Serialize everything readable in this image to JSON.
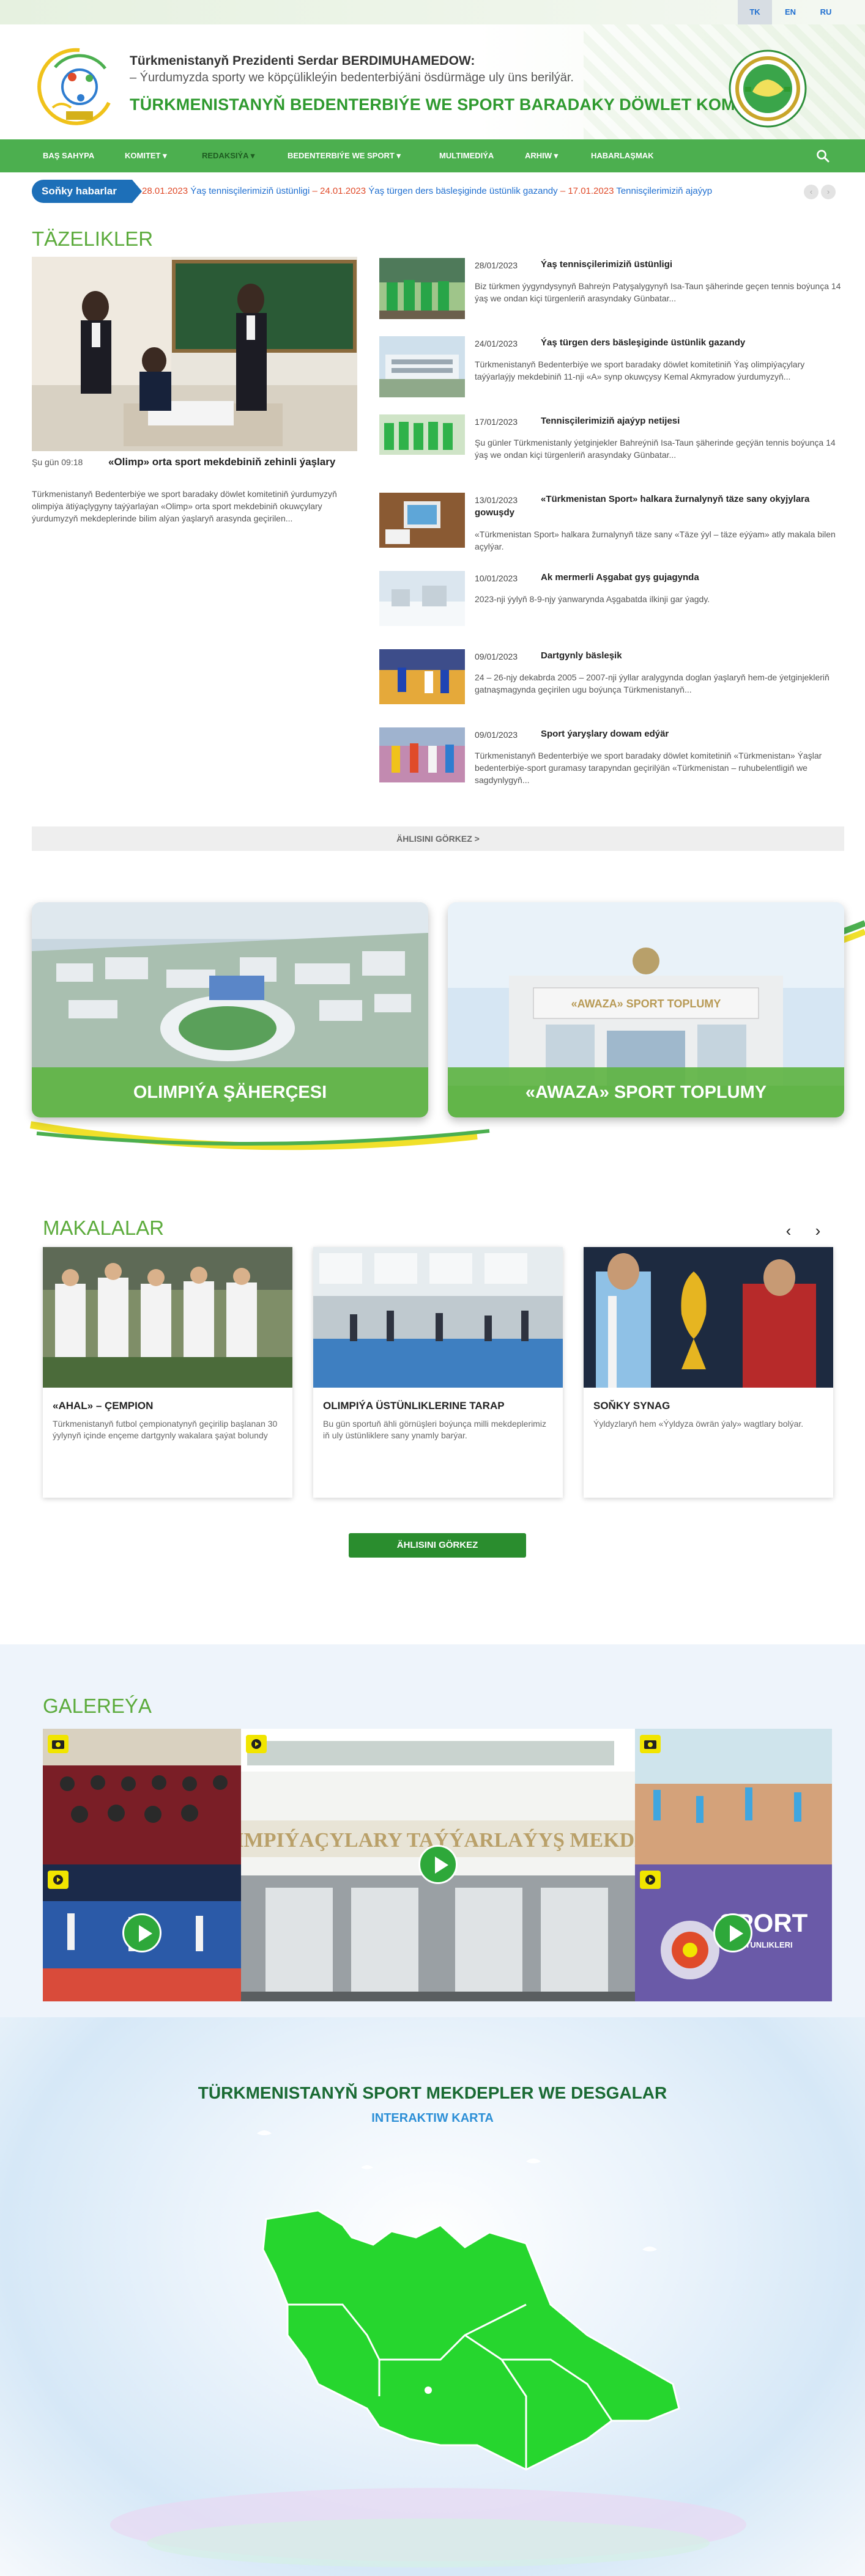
{
  "languages": [
    {
      "code": "TK",
      "active": true
    },
    {
      "code": "EN",
      "active": false
    },
    {
      "code": "RU",
      "active": false
    }
  ],
  "header": {
    "line1": "Türkmenistanyň Prezidenti Serdar BERDIMUHAMEDOW:",
    "line2": "– Ýurdumyzda sporty we köpçülikleýin bedenterbiýäni ösdürmäge uly üns berilýär.",
    "title": "TÜRKMENISTANYŇ BEDENTERBIÝE WE SPORT BARADAKY DÖWLET KOMITETI"
  },
  "nav": [
    {
      "label": "BAŞ SAHYPA"
    },
    {
      "label": "KOMITET ▾"
    },
    {
      "label": "REDAKSIÝA ▾"
    },
    {
      "label": "BEDENTERBIÝE WE SPORT ▾"
    },
    {
      "label": "MULTIMEDIÝA"
    },
    {
      "label": "ARHIW ▾"
    },
    {
      "label": "HABARLAŞMAK"
    }
  ],
  "ticker": {
    "label": "Soňky habarlar",
    "items": [
      {
        "date": "28.01.2023",
        "title": "Ýaş tennisçilerimiziň üstünligi"
      },
      {
        "date": "24.01.2023",
        "title": "Ýaş türgen ders bäsleşiginde üstünlik gazandy"
      },
      {
        "date": "17.01.2023",
        "title": "Tennisçilerimiziň ajaýyp"
      }
    ]
  },
  "news_section": {
    "title": "TÄZELIKLER",
    "featured": {
      "date": "Şu gün 09:18",
      "title": "«Olimp» orta sport mekdebiniň zehinli ýaşlary",
      "text": "Türkmenistanyň Bedenterbiýe we sport baradaky döwlet komitetiniň ýurdumyzyň olimpiýa ätiýaçlygyny taýýarlaýan «Olimp» orta sport mekdebiniň okuwçylary ýurdumyzyň mekdeplerinde bilim alýan ýaşlaryň arasynda geçirilen..."
    },
    "items": [
      {
        "date": "28/01/2023",
        "title": "Ýaş tennisçilerimiziň üstünligi",
        "text": "Biz türkmen ýygyndysynyň Bahreýn Patyşalygynyň Isa-Taun şäherinde geçen tennis boýunça 14 ýaş we ondan kiçi türgenleriň arasyndaky Günbatar..."
      },
      {
        "date": "24/01/2023",
        "title": "Ýaş türgen ders bäsleşiginde üstünlik gazandy",
        "text": "Türkmenistanyň Bedenterbiýe we sport baradaky döwlet komitetiniň Ýaş olimpiýaçylary taýýarlaýjy mekdebiniň 11-nji «A» synp okuwçysy Kemal Akmyradow ýurdumyzyň..."
      },
      {
        "date": "17/01/2023",
        "title": "Tennisçilerimiziň ajaýyp netijesi",
        "text": "Şu günler Türkmenistanly ýetginjekler Bahreýniň Isa-Taun şäherinde geçýän tennis boýunça 14 ýaş we ondan kiçi türgenleriň arasyndaky Günbatar..."
      },
      {
        "date": "13/01/2023",
        "title": "«Türkmenistan Sport» halkara žurnalynyň täze sany okyjylara gowuşdy",
        "text": "«Türkmenistan Sport» halkara žurnalynyň täze sany «Täze ýyl – täze eýýam» atly makala bilen açylýar."
      },
      {
        "date": "10/01/2023",
        "title": "Ak mermerli Aşgabat gyş gujagynda",
        "text": "2023-nji ýylyň 8-9-njy ýanwarynda Aşgabatda ilkinji gar ýagdy."
      },
      {
        "date": "09/01/2023",
        "title": "Dartgynly bäsleşik",
        "text": "24 – 26-njy dekabrda 2005 – 2007-nji ýyllar aralygynda doglan ýaşlaryň hem-de ýetginjekleriň gatnaşmagynda geçirilen ugu boýunça Türkmenistanyň..."
      },
      {
        "date": "09/01/2023",
        "title": "Sport ýaryşlary dowam edýär",
        "text": "Türkmenistanyň Bedenterbiýe we sport baradaky döwlet komitetiniň «Türkmenistan» Ýaşlar bedenterbiýe-sport guramasy tarapyndan geçirilýän «Türkmenistan – ruhubelentligiň we sagdynlygyň..."
      }
    ],
    "show_all": "ÄHLISINI GÖRKEZ >"
  },
  "features": [
    {
      "label": "OLIMPIÝA ŞÄHERÇESI"
    },
    {
      "label": "«AWAZA» SPORT TOPLUMY",
      "sign": "«AWAZA» SPORT TOPLUMY"
    }
  ],
  "articles": {
    "title": "MAKALALAR",
    "items": [
      {
        "title": "«AHAL» – ÇEMPION",
        "text": "Türkmenistanyň futbol çempionatynyň geçirilip başlanan 30 ýylynyň içinde ençeme dartgynly wakalara şaýat bolundy"
      },
      {
        "title": "OLIMPIÝA ÜSTÜNLIKLERINE TARAP",
        "text": "Bu gün sportuň ähli görnüşleri boýunça milli mekdeplerimiz iň uly üstünliklere sany ynamly barýar."
      },
      {
        "title": "SOŇKY SYNAG",
        "text": "Ýyldyzlaryň hem «Ýyldyza öwrän ýaly» wagtlary bolýar."
      }
    ],
    "show_all": "ÄHLISINI GÖRKEZ"
  },
  "gallery": {
    "title": "GALEREÝA",
    "center_sign": "OLIMPIÝAÇYLARY TAÝÝARLAÝYŞ MEKDEBI",
    "sport_text": "SPORT",
    "sport_sub": "USTUNLIKLERI"
  },
  "map": {
    "title": "TÜRKMENISTANYŇ SPORT MEKDEPLER WE DESGALAR",
    "subtitle": "INTERAKTIW KARTA"
  },
  "colors": {
    "brand_green": "#4caf4f",
    "title_green": "#2f9a2f",
    "ticker_blue": "#1d6fb8",
    "date_red": "#e04b2a",
    "map_green": "#26d62e"
  }
}
